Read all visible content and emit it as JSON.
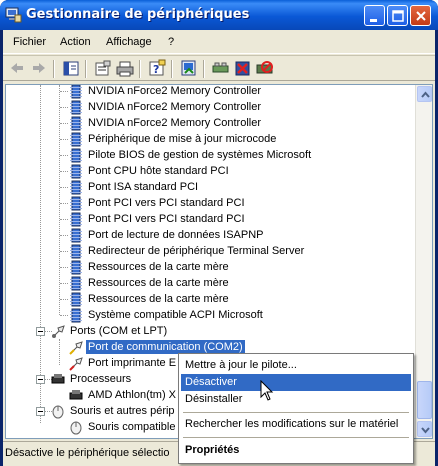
{
  "window": {
    "title": "Gestionnaire de périphériques",
    "title_icon": "computer-device-icon"
  },
  "menubar": {
    "items": [
      "Fichier",
      "Action",
      "Affichage",
      "?"
    ]
  },
  "toolbar": {
    "buttons": [
      "back-icon",
      "forward-icon",
      "show-tree-icon",
      "properties-icon",
      "print-icon",
      "help-icon",
      "update-driver-icon",
      "scan-hardware-icon",
      "uninstall-icon",
      "disable-icon"
    ]
  },
  "tree": {
    "items": [
      {
        "label": "NVIDIA nForce2 Memory Controller",
        "icon": "chip-icon"
      },
      {
        "label": "NVIDIA nForce2 Memory Controller",
        "icon": "chip-icon"
      },
      {
        "label": "NVIDIA nForce2 Memory Controller",
        "icon": "chip-icon"
      },
      {
        "label": "Périphérique de mise à jour microcode",
        "icon": "chip-icon"
      },
      {
        "label": "Pilote BIOS de gestion de systèmes Microsoft",
        "icon": "chip-icon"
      },
      {
        "label": "Pont CPU hôte standard PCI",
        "icon": "chip-icon"
      },
      {
        "label": "Pont ISA standard PCI",
        "icon": "chip-icon"
      },
      {
        "label": "Pont PCI vers PCI standard PCI",
        "icon": "chip-icon"
      },
      {
        "label": "Pont PCI vers PCI standard PCI",
        "icon": "chip-icon"
      },
      {
        "label": "Port de lecture de données ISAPNP",
        "icon": "chip-icon"
      },
      {
        "label": "Redirecteur de périphérique Terminal Server",
        "icon": "chip-icon"
      },
      {
        "label": "Ressources de la carte mère",
        "icon": "chip-icon"
      },
      {
        "label": "Ressources de la carte mère",
        "icon": "chip-icon"
      },
      {
        "label": "Ressources de la carte mère",
        "icon": "chip-icon"
      },
      {
        "label": "Système compatible ACPI Microsoft",
        "icon": "chip-icon"
      }
    ],
    "ports_category": "Ports (COM et LPT)",
    "ports_children": [
      "Port de communication (COM2)",
      "Port imprimante E"
    ],
    "processors_category": "Processeurs",
    "processors_children": [
      "AMD Athlon(tm) X"
    ],
    "mice_category": "Souris et autres périp",
    "mice_children": [
      "Souris compatible"
    ]
  },
  "context_menu": {
    "items": [
      "Mettre à jour le pilote...",
      "Désactiver",
      "Désinstaller",
      "Rechercher les modifications sur le matériel",
      "Propriétés"
    ],
    "highlighted": "Désactiver"
  },
  "statusbar": {
    "text": "Désactive le périphérique sélectio"
  },
  "colors": {
    "titlebar": "#0a58d6",
    "selection": "#316ac5",
    "frame": "#ece9d8"
  }
}
